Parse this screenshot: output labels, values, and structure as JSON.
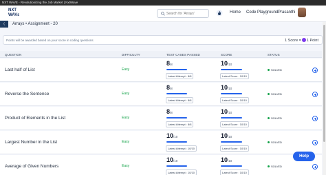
{
  "window": {
    "title": "NXT WAVE - Revolutionizing the Job Market | NxtWave"
  },
  "header": {
    "logo_line1": "NXT",
    "logo_line2": "WAVε",
    "search_placeholder": "Search for 'Arrays'",
    "nav": [
      "Home",
      "Code Playground"
    ],
    "user_name": "Prasanthi"
  },
  "breadcrumb": "Arrays • Assignment - 20",
  "notice": {
    "text": "Points will be awarded based on your score in coding questions",
    "score_left": "1 Score =",
    "score_right": "1 Point"
  },
  "table": {
    "headers": [
      "QUESTION",
      "DIFFICULTY",
      "TEST CASES PASSED",
      "SCORE",
      "STATUS"
    ],
    "rows": [
      {
        "question": "Last half of List",
        "difficulty": "Easy",
        "passed": "8",
        "total": "/8",
        "attempt": "Latest Attempt : 8/8",
        "score": "10",
        "score_total": "/10",
        "latest_score": "Latest Score : 10/10",
        "status": "SOLVED"
      },
      {
        "question": "Reverse the Sentence",
        "difficulty": "Easy",
        "passed": "8",
        "total": "/8",
        "attempt": "Latest Attempt : 8/8",
        "score": "10",
        "score_total": "/10",
        "latest_score": "Latest Score : 10/10",
        "status": "SOLVED"
      },
      {
        "question": "Product of Elements in the List",
        "difficulty": "Easy",
        "passed": "8",
        "total": "/8",
        "attempt": "Latest Attempt : 8/8",
        "score": "10",
        "score_total": "/10",
        "latest_score": "Latest Score : 10/10",
        "status": "SOLVED"
      },
      {
        "question": "Largest Number in the List",
        "difficulty": "Easy",
        "passed": "10",
        "total": "/10",
        "attempt": "Latest Attempt : 10/10",
        "score": "10",
        "score_total": "/10",
        "latest_score": "Latest Score : 10/10",
        "status": "SOLVED"
      },
      {
        "question": "Average of Given Numbers",
        "difficulty": "Easy",
        "passed": "10",
        "total": "/10",
        "attempt": "Latest Attempt : 10/10",
        "score": "10",
        "score_total": "/10",
        "latest_score": "Latest Score : 10/10",
        "status": "SOLVED"
      }
    ]
  },
  "help_label": "Help",
  "colors": {
    "accent": "#2563eb",
    "easy": "#16a34a",
    "solved_dot": "#16a34a",
    "back": "#1e3a5f"
  }
}
